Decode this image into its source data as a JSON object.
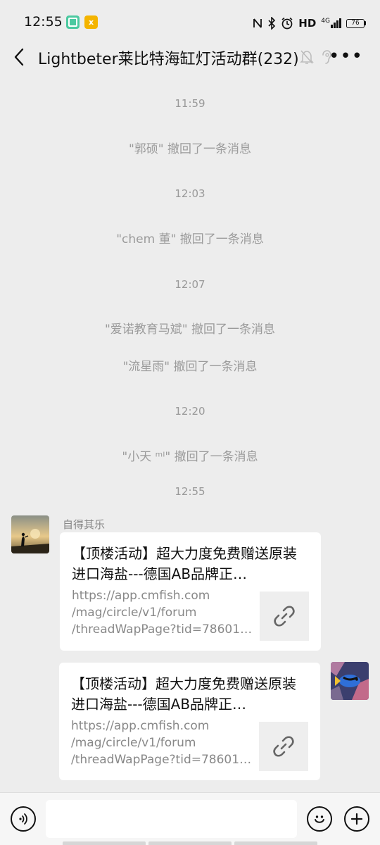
{
  "status_bar": {
    "time": "12:55",
    "network": "HD",
    "signal": "4G",
    "battery": "76"
  },
  "header": {
    "title": "Lightbeter莱比特海缸灯活动群(232)"
  },
  "messages": {
    "t1": "11:59",
    "recall1": "\"郭硕\" 撤回了一条消息",
    "t2": "12:03",
    "recall2": "\"chem 董\" 撤回了一条消息",
    "t3": "12:07",
    "recall3": "\"爱诺教育马斌\" 撤回了一条消息",
    "recall4": "\"流星雨\" 撤回了一条消息",
    "t4": "12:20",
    "recall5": "\"小天 ᵐᴵ\" 撤回了一条消息",
    "t5": "12:55"
  },
  "incoming": {
    "sender": "自得其乐",
    "title": "【顶楼活动】超大力度免费赠送原装进口海盐---德国AB品牌正…",
    "url_line1": "https://app.cmfish.com",
    "url_line2": "/mag/circle/v1/forum",
    "url_line3": "/threadWapPage?tid=78601…"
  },
  "outgoing": {
    "title": "【顶楼活动】超大力度免费赠送原装进口海盐---德国AB品牌正…",
    "url_line1": "https://app.cmfish.com",
    "url_line2": "/mag/circle/v1/forum",
    "url_line3": "/threadWapPage?tid=78601…"
  },
  "input": {
    "value": ""
  },
  "colors": {
    "background": "#ededed",
    "bubble": "#ffffff",
    "system_text": "#9b9b9b"
  },
  "icons": [
    "voice-icon",
    "emoji-icon",
    "plus-icon",
    "link-icon",
    "back-icon",
    "more-icon",
    "mute-bell-icon",
    "earpiece-icon"
  ]
}
